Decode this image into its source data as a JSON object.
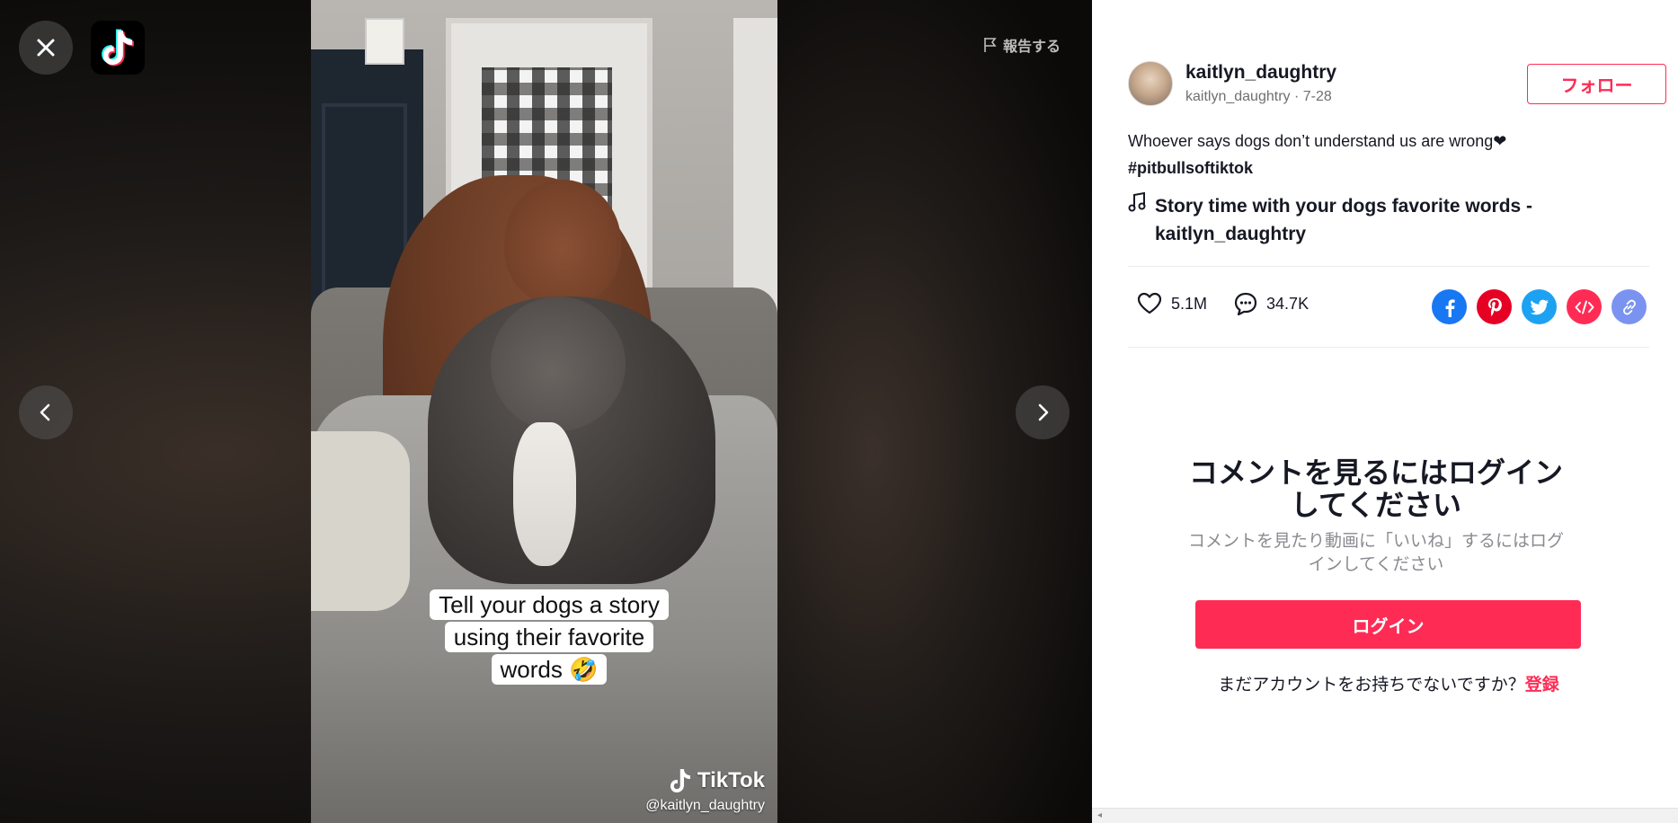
{
  "video": {
    "caption_lines": [
      "Tell your dogs a story",
      "using their favorite",
      "words 🤣"
    ],
    "watermark_brand": "TikTok",
    "watermark_handle": "@kaitlyn_daughtry"
  },
  "controls": {
    "close_icon": "close-icon",
    "prev_icon": "chevron-left-icon",
    "next_icon": "chevron-right-icon",
    "report_label": "報告する"
  },
  "author": {
    "username": "kaitlyn_daughtry",
    "subline": "kaitlyn_daughtry · 7-28",
    "follow_label": "フォロー"
  },
  "post": {
    "description": "Whoever says dogs don’t understand us are wrong❤",
    "hashtag": "#pitbullsoftiktok",
    "music": "Story time with your dogs favorite words - kaitlyn_daughtry"
  },
  "stats": {
    "likes": "5.1M",
    "comments": "34.7K"
  },
  "shares": [
    "facebook-icon",
    "pinterest-icon",
    "twitter-icon",
    "embed-icon",
    "link-icon"
  ],
  "colors": {
    "accent": "#fe2c55",
    "facebook": "#1877f2",
    "pinterest": "#e60023",
    "twitter": "#1da1f2",
    "embed": "#fe2c55",
    "link": "#7b93f0"
  },
  "login": {
    "title": "コメントを見るにはログインしてください",
    "subtitle": "コメントを見たり動画に「いいね」するにはログインしてください",
    "button": "ログイン",
    "no_account": "まだアカウントをお持ちでないですか？",
    "signup": "登録"
  }
}
